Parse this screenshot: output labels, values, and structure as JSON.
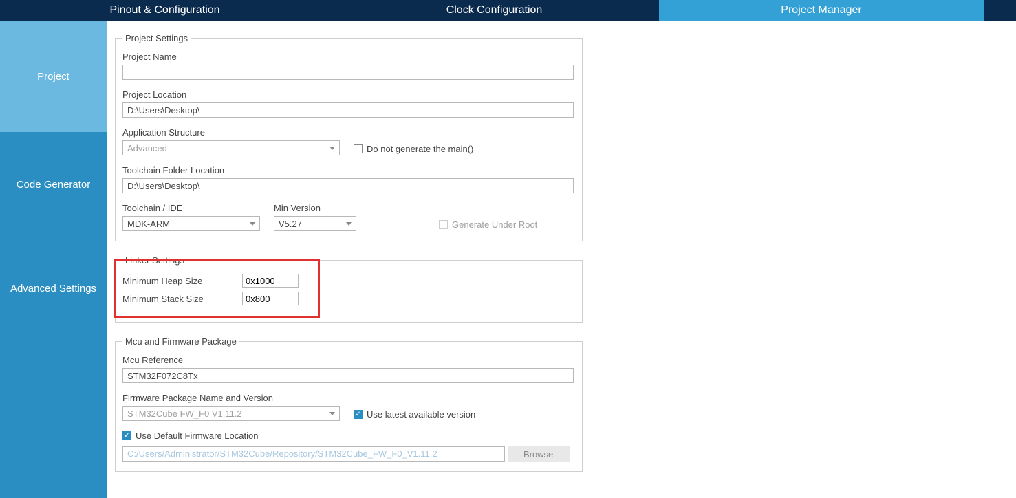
{
  "tabs": {
    "pinout": "Pinout & Configuration",
    "clock": "Clock Configuration",
    "pm": "Project Manager"
  },
  "sidebar": {
    "project": "Project",
    "codegen": "Code Generator",
    "advanced": "Advanced Settings"
  },
  "project_settings": {
    "legend": "Project Settings",
    "name_label": "Project Name",
    "name_value": "",
    "location_label": "Project Location",
    "location_value": "D:\\Users\\Desktop\\",
    "app_struct_label": "Application Structure",
    "app_struct_value": "Advanced",
    "no_main_label": "Do not generate the main()",
    "toolchain_folder_label": "Toolchain Folder Location",
    "toolchain_folder_value": "D:\\Users\\Desktop\\",
    "toolchain_ide_label": "Toolchain / IDE",
    "toolchain_ide_value": "MDK-ARM",
    "min_version_label": "Min Version",
    "min_version_value": "V5.27",
    "gen_under_root_label": "Generate Under Root"
  },
  "linker": {
    "legend": "Linker Settings",
    "heap_label": "Minimum Heap Size",
    "heap_value": "0x1000",
    "stack_label": "Minimum Stack Size",
    "stack_value": "0x800"
  },
  "mcu_fw": {
    "legend": "Mcu and Firmware Package",
    "mcu_ref_label": "Mcu Reference",
    "mcu_ref_value": "STM32F072C8Tx",
    "fw_name_label": "Firmware Package Name and Version",
    "fw_name_value": "STM32Cube FW_F0 V1.11.2",
    "use_latest_label": "Use latest available version",
    "use_default_fw_label": "Use Default Firmware Location",
    "fw_location_value": "C:/Users/Administrator/STM32Cube/Repository/STM32Cube_FW_F0_V1.11.2",
    "browse_label": "Browse"
  }
}
